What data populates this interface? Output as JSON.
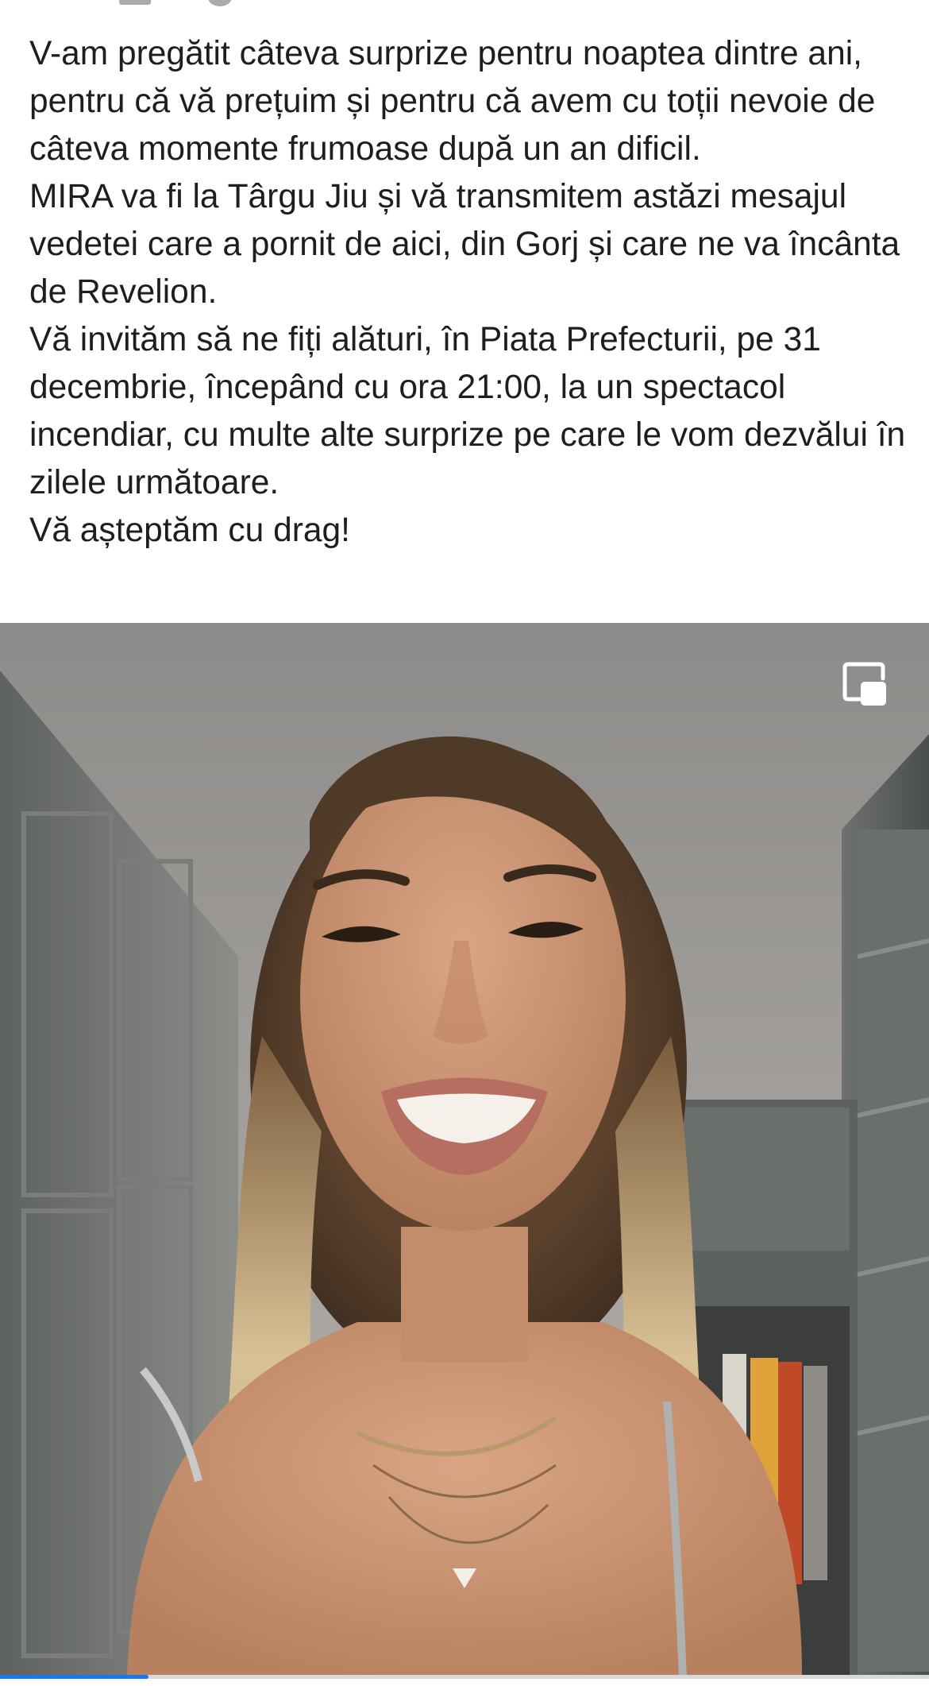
{
  "post": {
    "paragraphs": [
      "V-am pregătit câteva surprize pentru noaptea dintre ani, pentru că vă prețuim și pentru că avem cu toții nevoie de câteva momente frumoase după un an dificil.",
      "MIRA va fi la Târgu Jiu și vă transmitem astăzi mesajul vedetei care a pornit de aici, din Gorj și care ne va încânta de Revelion.",
      "Vă invităm să ne fiți alături, în Piata Prefecturii, pe 31 decembrie, începând cu ora 21:00, la un spectacol incendiar, cu multe alte surprize pe care le vom dezvălui în zilele următoare.",
      "Vă așteptăm cu drag!"
    ]
  },
  "video": {
    "pip_icon": "picture-in-picture-icon",
    "progress_fraction": 0.16
  },
  "colors": {
    "text": "#1c1e21",
    "progress": "#1877f2",
    "pip_icon": "#ffffff"
  }
}
